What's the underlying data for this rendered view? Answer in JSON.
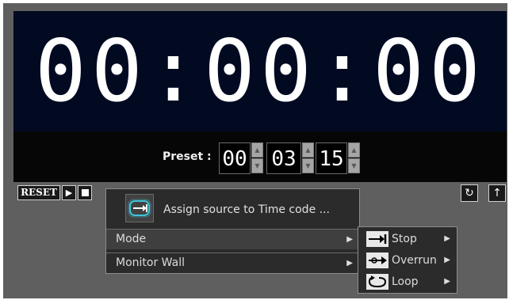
{
  "timer": {
    "display": "00:00:00"
  },
  "preset": {
    "label": "Preset :",
    "hours": "00",
    "minutes": "03",
    "seconds": "15",
    "spin_up": "▲",
    "spin_down": "▼"
  },
  "controls": {
    "reset_label": "RESET",
    "play_symbol": "▶",
    "loop_symbol": "↻",
    "up_symbol": "↑"
  },
  "context_menu": {
    "assign_label": "Assign source to Time code ...",
    "items": [
      {
        "label": "Mode",
        "arrow": "▶"
      },
      {
        "label": "Monitor Wall",
        "arrow": "▶"
      }
    ]
  },
  "mode_submenu": {
    "items": [
      {
        "label": "Stop",
        "icon": "stop-arrow-icon",
        "arrow": "▶"
      },
      {
        "label": "Overrun",
        "icon": "overrun-icon",
        "arrow": "▶"
      },
      {
        "label": "Loop",
        "icon": "loop-icon",
        "arrow": "▶"
      }
    ]
  },
  "colors": {
    "display_bg": "#020a22",
    "panel_bg": "#5f5f5f",
    "menu_bg": "#2b2b2b",
    "menu_highlight": "#3f3f3f",
    "accent_icon": "#3fc3d8"
  }
}
